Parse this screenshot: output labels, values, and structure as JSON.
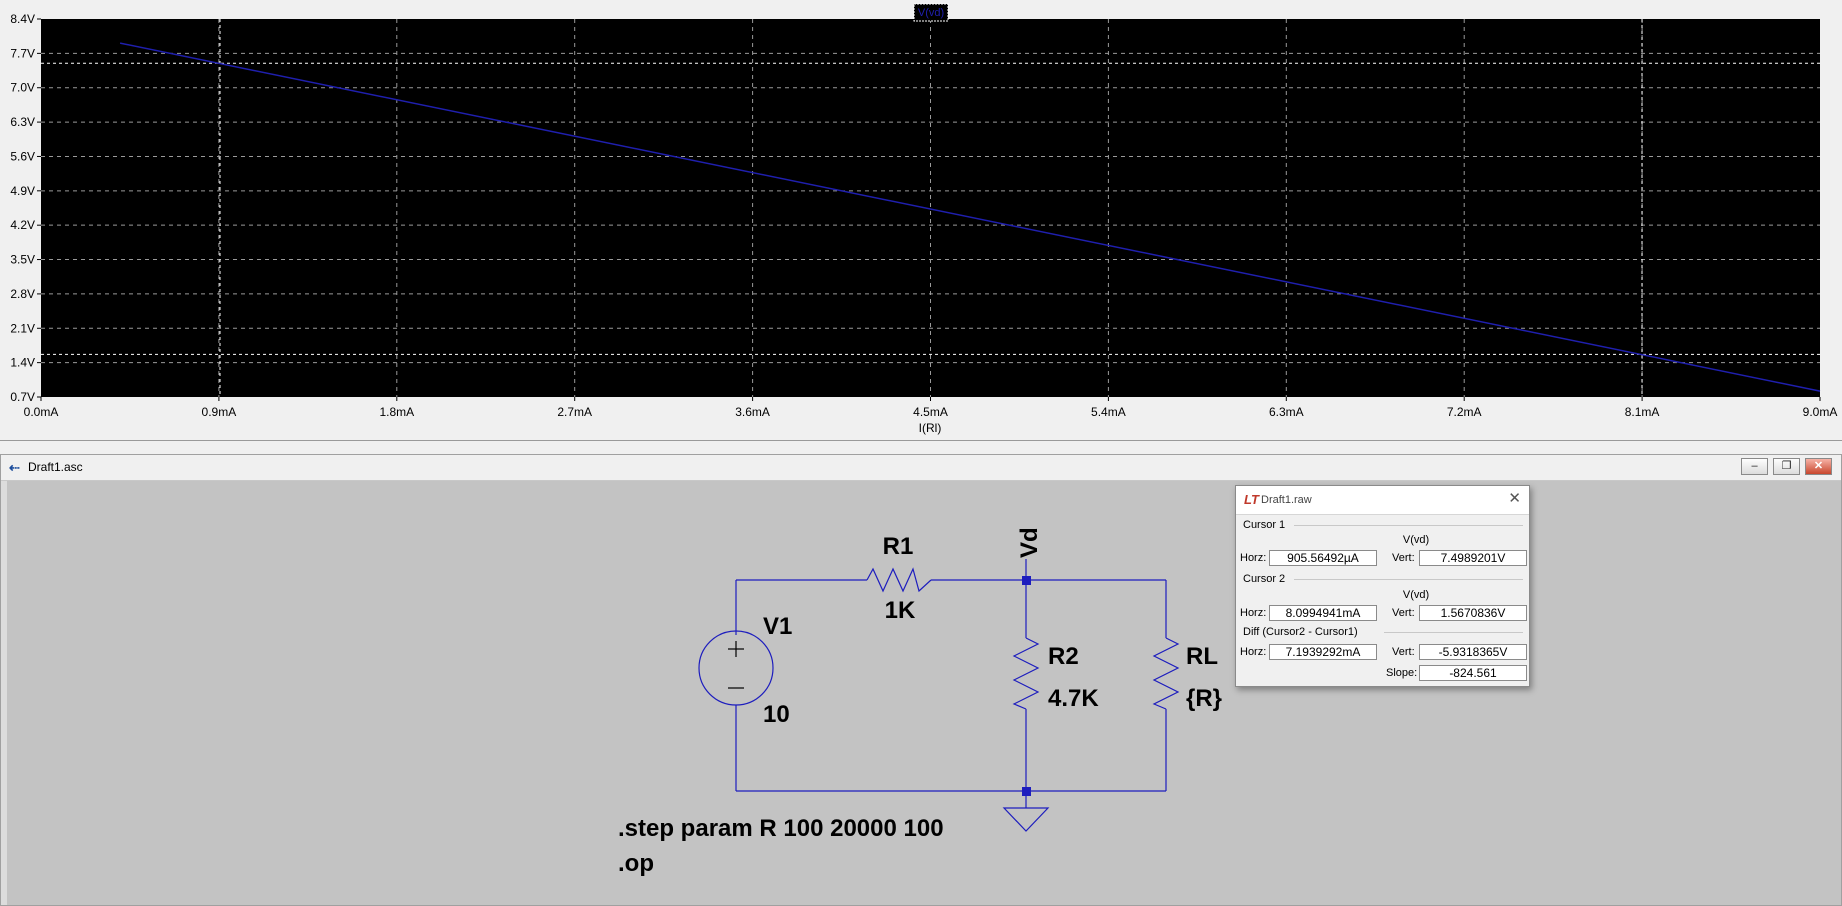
{
  "plot": {
    "trace_label": "V(vd)",
    "xlabel": "I(Rl)",
    "colors": {
      "background": "#000000",
      "grid": "#ffffff",
      "trace": "#1f1fae",
      "axes_text": "#000000"
    }
  },
  "chart_data": {
    "type": "line",
    "title": "V(vd)",
    "xlabel": "I(Rl)",
    "ylabel": "",
    "x_unit": "mA",
    "y_unit": "V",
    "xlim": [
      0.0,
      9.0
    ],
    "ylim": [
      0.7,
      8.4
    ],
    "x_ticks": [
      "0.0mA",
      "0.9mA",
      "1.8mA",
      "2.7mA",
      "3.6mA",
      "4.5mA",
      "5.4mA",
      "6.3mA",
      "7.2mA",
      "8.1mA",
      "9.0mA"
    ],
    "y_ticks": [
      "8.4V",
      "7.7V",
      "7.0V",
      "6.3V",
      "5.6V",
      "4.9V",
      "4.2V",
      "3.5V",
      "2.8V",
      "2.1V",
      "1.4V",
      "0.7V"
    ],
    "grid": true,
    "series": [
      {
        "name": "V(vd)",
        "x": [
          0.4,
          9.0
        ],
        "y": [
          7.91,
          0.82
        ]
      }
    ],
    "cursors": [
      {
        "name": "Cursor 1",
        "x": 0.905565,
        "y": 7.4989201
      },
      {
        "name": "Cursor 2",
        "x": 8.0994941,
        "y": 1.5670836
      }
    ]
  },
  "schematic_window": {
    "title": "Draft1.asc",
    "labels": {
      "R1": "R1",
      "R1_value": "1K",
      "R2": "R2",
      "R2_value": "4.7K",
      "RL": "RL",
      "RL_value": "{R}",
      "V1": "V1",
      "V1_value": "10",
      "net": "Vd"
    },
    "directives": [
      ".step param R 100 20000 100",
      ".op"
    ]
  },
  "cursor_dialog": {
    "title": "Draft1.raw",
    "cursor1": {
      "label": "Cursor 1",
      "trace": "V(vd)",
      "horz_label": "Horz:",
      "horz": "905.56492µA",
      "vert_label": "Vert:",
      "vert": "7.4989201V"
    },
    "cursor2": {
      "label": "Cursor 2",
      "trace": "V(vd)",
      "horz_label": "Horz:",
      "horz": "8.0994941mA",
      "vert_label": "Vert:",
      "vert": "1.5670836V"
    },
    "diff": {
      "label": "Diff (Cursor2 - Cursor1)",
      "horz_label": "Horz:",
      "horz": "7.1939292mA",
      "vert_label": "Vert:",
      "vert": "-5.9318365V",
      "slope_label": "Slope:",
      "slope": "-824.561"
    }
  }
}
